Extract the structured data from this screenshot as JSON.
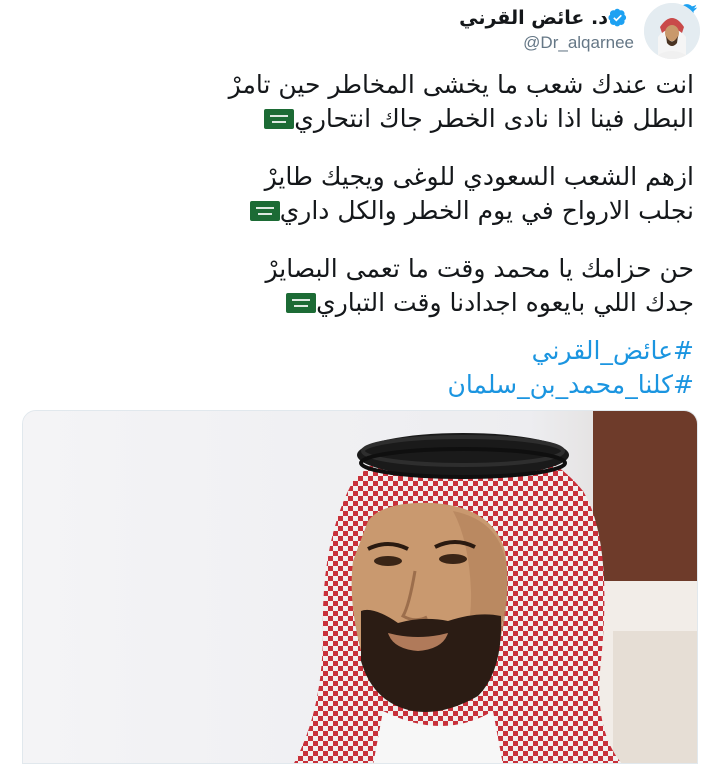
{
  "author": {
    "display_name": "د. عائض القرني",
    "handle": "@Dr_alqarnee",
    "verified": true
  },
  "tweet": {
    "stanzas": [
      {
        "lines": [
          {
            "text": "انت عندك شعب ما يخشى المخاطر حين تامرْ",
            "flag": false
          },
          {
            "text": "البطل فينا اذا نادى الخطر جاك انتحاري",
            "flag": true
          }
        ]
      },
      {
        "lines": [
          {
            "text": "ازهم الشعب السعودي للوغى ويجيك طايرْ",
            "flag": false
          },
          {
            "text": "نجلب الارواح في يوم الخطر والكل داري",
            "flag": true
          }
        ]
      },
      {
        "lines": [
          {
            "text": "حن حزامك يا محمد وقت ما تعمى البصايرْ",
            "flag": false
          },
          {
            "text": "جدك اللي بايعوه اجدادنا وقت التباري",
            "flag": true
          }
        ]
      }
    ],
    "hashtags": [
      "#عائض_القرني",
      "#كلنا_محمد_بن_سلمان"
    ]
  },
  "icons": {
    "brand": "twitter-bird-icon",
    "verified": "verified-badge-icon",
    "flag": "saudi-flag-emoji"
  },
  "colors": {
    "brand_blue": "#1da1f2",
    "hashtag_blue": "#1b95e0",
    "handle_gray": "#657786",
    "text": "#14171a",
    "flag_green": "#1c6b35"
  }
}
